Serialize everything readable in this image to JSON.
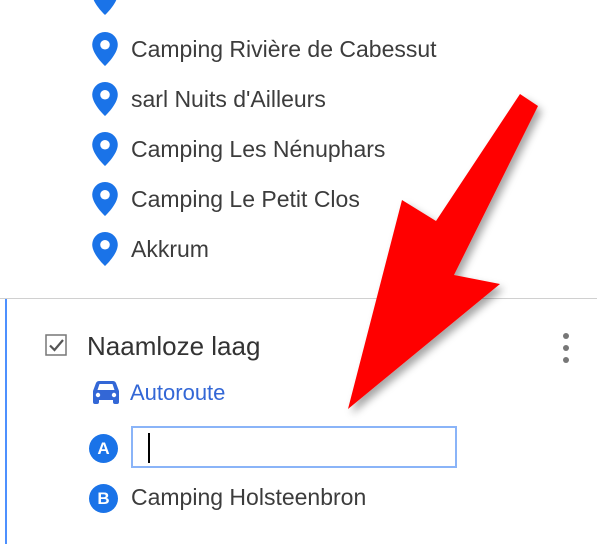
{
  "places": [
    {
      "label": "Camping Rivière de Cabessut",
      "icon": "location-pin-icon"
    },
    {
      "label": "sarl Nuits d'Ailleurs",
      "icon": "location-pin-icon"
    },
    {
      "label": "Camping Les Nénuphars",
      "icon": "location-pin-icon"
    },
    {
      "label": "Camping Le Petit Clos",
      "icon": "location-pin-icon"
    },
    {
      "label": "Akkrum",
      "icon": "location-pin-icon"
    }
  ],
  "layer": {
    "title": "Naamloze laag",
    "checked": true,
    "route_label": "Autoroute",
    "route_icon": "car-icon",
    "waypoint_a": {
      "badge": "A",
      "value": ""
    },
    "waypoint_b": {
      "badge": "B",
      "label": "Camping Holsteenbron"
    }
  },
  "colors": {
    "pin": "#1a73e8",
    "badge": "#1a73e8",
    "link": "#3367d6",
    "input_border": "#8ab4f8",
    "annotation_arrow": "#ff0000"
  }
}
